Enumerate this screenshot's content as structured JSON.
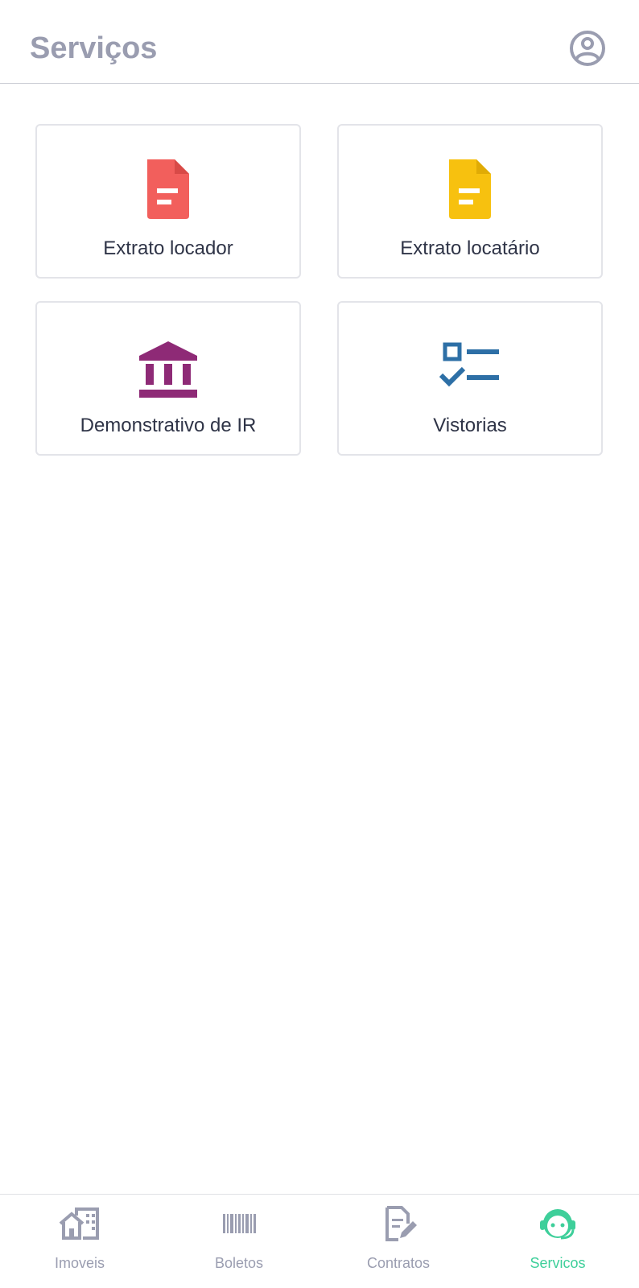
{
  "header": {
    "title": "Serviços",
    "profile_icon": "user-circle-icon"
  },
  "colors": {
    "title_gray": "#9a9db0",
    "text_dark": "#2f3447",
    "red": "#f25f5c",
    "yellow": "#f7c10f",
    "purple": "#8e2a76",
    "blue": "#2d6fa6",
    "green_active": "#3ecf9a"
  },
  "services": [
    {
      "label": "Extrato locador",
      "icon": "document-icon"
    },
    {
      "label": "Extrato locatário",
      "icon": "document-icon"
    },
    {
      "label": "Demonstrativo de IR",
      "icon": "bank-icon"
    },
    {
      "label": "Vistorias",
      "icon": "checklist-icon"
    }
  ],
  "tabs": [
    {
      "label": "Imoveis",
      "icon": "buildings-icon",
      "active": false
    },
    {
      "label": "Boletos",
      "icon": "barcode-icon",
      "active": false
    },
    {
      "label": "Contratos",
      "icon": "contract-edit-icon",
      "active": false
    },
    {
      "label": "Servicos",
      "icon": "support-agent-icon",
      "active": true
    }
  ]
}
